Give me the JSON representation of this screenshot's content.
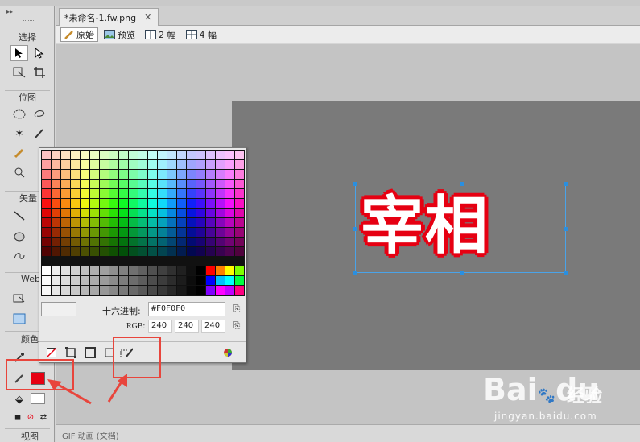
{
  "document": {
    "tab_title": "*未命名-1.fw.png",
    "close_glyph": "✕"
  },
  "viewbar": {
    "original": "原始",
    "preview": "预览",
    "two_up": "2 幅",
    "four_up": "4 幅"
  },
  "tools": {
    "select_heading": "选择",
    "bitmap_heading": "位图",
    "vector_heading": "矢量",
    "web_heading": "Web",
    "colors_heading": "颜色",
    "view_heading": "视图"
  },
  "canvas": {
    "text_content": "宰相",
    "text_color": "#ffffff",
    "stroke_color": "#e60012",
    "canvas_bg": "#7a7a7a"
  },
  "color_popup": {
    "hex_label": "十六进制:",
    "hex_value": "#F0F0F0",
    "rgb_label": "RGB:",
    "r": "240",
    "g": "240",
    "b": "240"
  },
  "statusbar": {
    "text": "GIF 动画 (文档)"
  },
  "stroke_swatch_color": "#e60012",
  "watermark": {
    "logo": "Bai",
    "logo_paw": "du",
    "cn": "经验",
    "url": "jingyan.baidu.com"
  }
}
